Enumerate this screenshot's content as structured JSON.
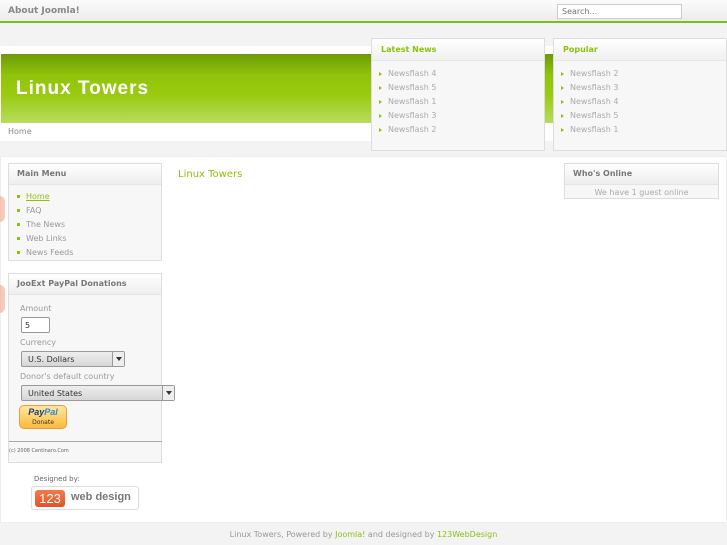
{
  "topbar": {
    "about_link": "About Joomla!",
    "search_placeholder": "Search..."
  },
  "header": {
    "site_title": "Linux Towers",
    "breadcrumb": "Home"
  },
  "latest_news": {
    "title": "Latest News",
    "items": [
      "Newsflash 4",
      "Newsflash 5",
      "Newsflash 1",
      "Newsflash 3",
      "Newsflash 2"
    ]
  },
  "popular": {
    "title": "Popular",
    "items": [
      "Newsflash 2",
      "Newsflash 3",
      "Newsflash 4",
      "Newsflash 5",
      "Newsflash 1"
    ]
  },
  "main_menu": {
    "title": "Main Menu",
    "items": [
      "Home",
      "FAQ",
      "The News",
      "Web Links",
      "News Feeds"
    ],
    "active": "Home"
  },
  "donations": {
    "title": "JooExt PayPal Donations",
    "amount_label": "Amount",
    "amount_value": "5",
    "currency_label": "Currency",
    "currency_value": "U.S. Dollars",
    "country_label": "Donor's default country",
    "country_value": "United States",
    "paypal_brand_pay": "Pay",
    "paypal_brand_pal": "Pal",
    "donate_label": "Donate",
    "copyright": "(c) 2008 Centinaro.Com"
  },
  "designed_by": {
    "label": "Designed by:",
    "logo_number": "123",
    "logo_text": "web design"
  },
  "content": {
    "title": "Linux Towers"
  },
  "whos_online": {
    "title": "Who's Online",
    "text": "We have 1 guest online"
  },
  "footer": {
    "prefix": "Linux Towers, Powered by ",
    "joomla_link": "Joomla!",
    "middle": " and designed by ",
    "designer_link": "123WebDesign"
  },
  "colors": {
    "accent": "#8cc00f",
    "header_dark": "#6c9a09",
    "header_light": "#b8dc5e"
  }
}
